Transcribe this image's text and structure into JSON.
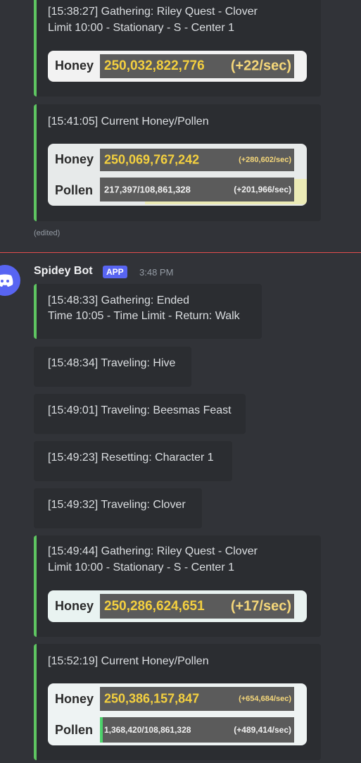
{
  "messages": [
    {
      "lines": [
        "[15:38:27] Gathering: Riley Quest - Clover",
        "Limit 10:00 - Stationary - S - Center 1"
      ],
      "stats": [
        {
          "label": "Honey",
          "value": "250,032,822,776",
          "rate": "(+22/sec)"
        }
      ]
    },
    {
      "lines": [
        "[15:41:05] Current Honey/Pollen"
      ],
      "stats": [
        {
          "label": "Honey",
          "value": "250,069,767,242",
          "rate": "(+280,602/sec)"
        },
        {
          "label": "Pollen",
          "value": "217,397/108,861,328",
          "rate": "(+201,966/sec)",
          "fill": 0.002
        }
      ]
    }
  ],
  "edited_label": "(edited)",
  "author": {
    "name": "Spidey Bot",
    "badge": "APP",
    "time": "3:48 PM",
    "avatar_icon": "discord-logo-icon"
  },
  "bot_messages": [
    {
      "lines": [
        "[15:48:33] Gathering: Ended",
        "Time 10:05 - Time Limit - Return: Walk"
      ]
    },
    {
      "lines": [
        "[15:48:34] Traveling: Hive"
      ]
    },
    {
      "lines": [
        "[15:49:01] Traveling: Beesmas Feast"
      ]
    },
    {
      "lines": [
        "[15:49:23] Resetting: Character 1"
      ]
    },
    {
      "lines": [
        "[15:49:32] Traveling: Clover"
      ]
    },
    {
      "lines": [
        "[15:49:44] Gathering: Riley Quest - Clover",
        "Limit 10:00 - Stationary - S - Center 1"
      ],
      "stats": [
        {
          "label": "Honey",
          "value": "250,286,624,651",
          "rate": "(+17/sec)"
        }
      ]
    },
    {
      "lines": [
        "[15:52:19] Current Honey/Pollen"
      ],
      "stats": [
        {
          "label": "Honey",
          "value": "250,386,157,847",
          "rate": "(+654,684/sec)"
        },
        {
          "label": "Pollen",
          "value": "1,368,420/108,861,328",
          "rate": "(+489,414/sec)",
          "fill": 0.0126
        }
      ]
    }
  ],
  "colors": {
    "accent": "#5ec561",
    "background": "#313338",
    "embed": "#2b2d31",
    "divider": "#e14d4d",
    "brand": "#5865f2"
  }
}
